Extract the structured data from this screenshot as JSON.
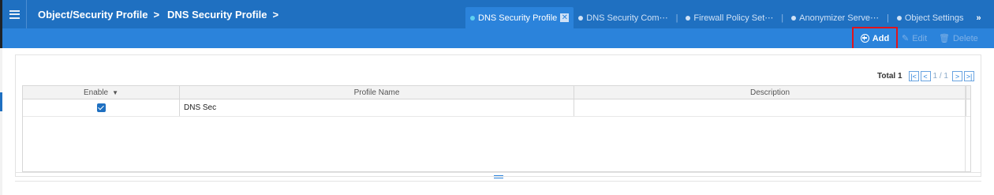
{
  "breadcrumb": {
    "items": [
      "Object/Security Profile",
      "DNS Security Profile"
    ],
    "separator": ">"
  },
  "tabs": [
    {
      "label": "DNS Security Profile",
      "active": true
    },
    {
      "label": "DNS Security Com⋯",
      "active": false
    },
    {
      "label": "Firewall Policy Set⋯",
      "active": false
    },
    {
      "label": "Anonymizer Serve⋯",
      "active": false
    },
    {
      "label": "Object Settings",
      "active": false
    }
  ],
  "tabs_more": "»",
  "tab_separator": "|",
  "tab_close": "✕",
  "toolbar": {
    "add_label": "Add",
    "edit_label": "Edit",
    "delete_label": "Delete"
  },
  "pager": {
    "total_label": "Total 1",
    "page_text": "1 / 1",
    "first": "|<",
    "prev": "<",
    "next": ">",
    "last": ">|"
  },
  "table": {
    "columns": [
      "Enable",
      "Profile Name",
      "Description"
    ],
    "sort_indicator": "▼",
    "rows": [
      {
        "enabled": true,
        "profile_name": "DNS Sec",
        "description": ""
      }
    ]
  },
  "colors": {
    "header_blue": "#1f70c1",
    "toolbar_blue": "#2b83db",
    "highlight_red": "#e0141c"
  }
}
